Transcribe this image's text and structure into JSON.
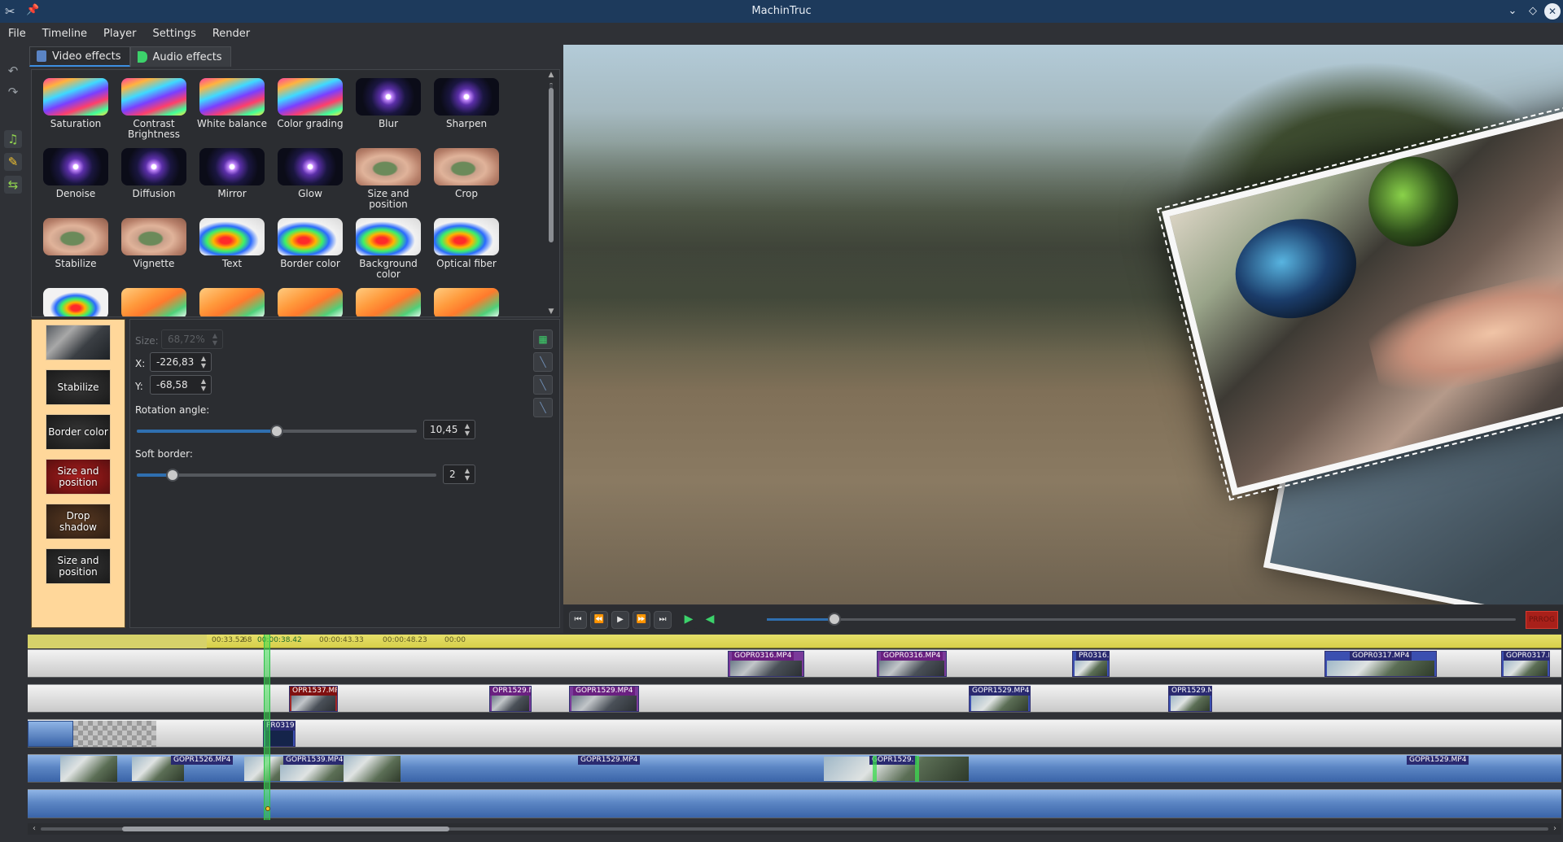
{
  "window": {
    "title": "MachinTruc"
  },
  "menu": [
    "File",
    "Timeline",
    "Player",
    "Settings",
    "Render"
  ],
  "tabs": {
    "video": "Video effects",
    "audio": "Audio effects"
  },
  "effects": [
    {
      "label": "Saturation",
      "thumb": "rainbow"
    },
    {
      "label": "Contrast Brightness",
      "thumb": "rainbow"
    },
    {
      "label": "White balance",
      "thumb": "rainbow"
    },
    {
      "label": "Color grading",
      "thumb": "rainbow"
    },
    {
      "label": "Blur",
      "thumb": "lens"
    },
    {
      "label": "Sharpen",
      "thumb": "lens"
    },
    {
      "label": "Denoise",
      "thumb": "lens"
    },
    {
      "label": "Diffusion",
      "thumb": "lens"
    },
    {
      "label": "Mirror",
      "thumb": "lens"
    },
    {
      "label": "Glow",
      "thumb": "lens"
    },
    {
      "label": "Size and position",
      "thumb": "hand"
    },
    {
      "label": "Crop",
      "thumb": "hand"
    },
    {
      "label": "Stabilize",
      "thumb": "hand"
    },
    {
      "label": "Vignette",
      "thumb": "hand"
    },
    {
      "label": "Text",
      "thumb": "flame"
    },
    {
      "label": "Border color",
      "thumb": "flame"
    },
    {
      "label": "Background color",
      "thumb": "flame"
    },
    {
      "label": "Optical fiber",
      "thumb": "flame"
    }
  ],
  "effects_partial_row": [
    "rainbow2",
    "orange",
    "orange",
    "orange",
    "orange",
    "orange"
  ],
  "effect_stack": [
    {
      "label": "",
      "style": "photo"
    },
    {
      "label": "Stabilize",
      "style": "dark"
    },
    {
      "label": "Border color",
      "style": "dark"
    },
    {
      "label": "Size and position",
      "style": "red"
    },
    {
      "label": "Drop shadow",
      "style": "brown"
    },
    {
      "label": "Size and position",
      "style": "dark"
    }
  ],
  "properties": {
    "size_label": "Size:",
    "size_value": "68,72%",
    "x_label": "X:",
    "x_value": "-226,83",
    "y_label": "Y:",
    "y_value": "-68,58",
    "rotation_label": "Rotation angle:",
    "rotation_value": "10,45",
    "rotation_fraction": 0.5,
    "soft_border_label": "Soft border:",
    "soft_border_value": "2",
    "soft_border_fraction": 0.12
  },
  "player": {
    "position_fraction": 0.09,
    "record_label": "PRROG"
  },
  "timeline": {
    "ruler_ticks": [
      "00:33.52",
      "68",
      "00:00:38.42",
      "00:00:43.33",
      "00:00:48.23",
      "00:00"
    ],
    "tracks": [
      {
        "kind": "grey",
        "clips": [
          {
            "name": "GOPR0316.MP4",
            "color": "purple"
          },
          {
            "name": "GOPR0316.MP4",
            "color": "purple"
          },
          {
            "name": "PR0316.M",
            "color": "blue"
          },
          {
            "name": "GOPR0317.MP4",
            "color": "blue"
          },
          {
            "name": "GOPR0317.MP",
            "color": "blue"
          }
        ]
      },
      {
        "kind": "grey",
        "clips": [
          {
            "name": "OPR1537.MP",
            "color": "red"
          },
          {
            "name": "OPR1529.M",
            "color": "purple"
          },
          {
            "name": "GOPR1529.MP4",
            "color": "purple"
          },
          {
            "name": "GOPR1529.MP4",
            "color": "blue"
          },
          {
            "name": "OPR1529.M",
            "color": "blue"
          }
        ]
      },
      {
        "kind": "grey",
        "clips": [
          {
            "name": "PR0319.",
            "color": "blue"
          }
        ]
      },
      {
        "kind": "blue",
        "clips": [
          {
            "name": "GOPR1526.MP4",
            "color": "blue"
          },
          {
            "name": "GOPR1539.MP4",
            "color": "blue"
          },
          {
            "name": "GOPR1529.MP4",
            "color": "blue"
          },
          {
            "name": "GOPR1529.",
            "color": "blue"
          },
          {
            "name": "GOPR1529.MP4",
            "color": "blue"
          }
        ]
      },
      {
        "kind": "blue",
        "clips": []
      }
    ],
    "scroll_fraction": 0.06
  }
}
